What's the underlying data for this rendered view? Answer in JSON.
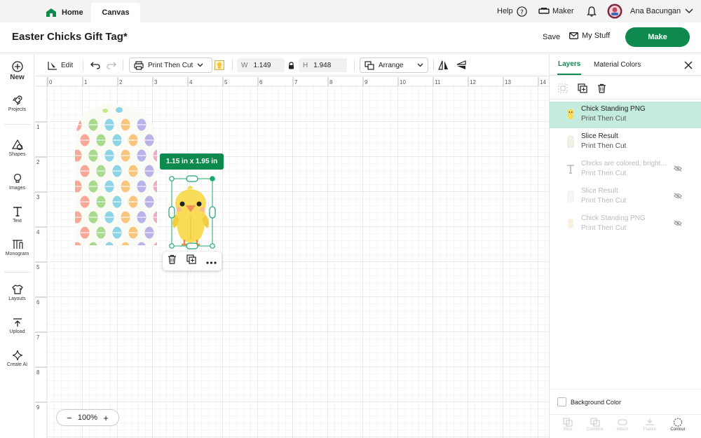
{
  "tabs": {
    "home": "Home",
    "canvas": "Canvas"
  },
  "top_right": {
    "help": "Help",
    "machine": "Maker",
    "user_name": "Ana Bacungan"
  },
  "project": {
    "title": "Easter Chicks Gift Tag*",
    "save": "Save",
    "my_stuff": "My Stuff",
    "make": "Make"
  },
  "left_nav": {
    "new": "New",
    "projects": "Projects",
    "shapes": "Shapes",
    "images": "Images",
    "text": "Text",
    "monogram": "Monogram",
    "layouts": "Layouts",
    "upload": "Upload",
    "create_ai": "Create AI"
  },
  "toolbar": {
    "edit": "Edit",
    "operation": "Print Then Cut",
    "w_label": "W",
    "w_value": "1.149",
    "h_label": "H",
    "h_value": "1.948",
    "arrange": "Arrange"
  },
  "ruler": {
    "horizontal": [
      "0",
      "1",
      "2",
      "3",
      "4",
      "5",
      "6",
      "7",
      "8",
      "9",
      "10",
      "11",
      "12",
      "13",
      "14"
    ],
    "vertical": [
      "1",
      "2",
      "3",
      "4",
      "5",
      "6",
      "7",
      "8",
      "9"
    ]
  },
  "canvas": {
    "size_badge": "1.15  in x 1.95  in",
    "zoom": "100%"
  },
  "panel": {
    "tab_layers": "Layers",
    "tab_material": "Material Colors",
    "layers": [
      {
        "name": "Chick Standing PNG",
        "sub": "Print Then Cut"
      },
      {
        "name": "Slice Result",
        "sub": "Print Then Cut"
      },
      {
        "name": "Chicks are colored, bright...",
        "sub": "Print Then Cut"
      },
      {
        "name": "Slice Result",
        "sub": "Print Then Cut"
      },
      {
        "name": "Chick Standing PNG",
        "sub": "Print Then Cut"
      }
    ],
    "background_color": "Background Color",
    "bottom_tools": {
      "slice": "Slice",
      "combine": "Combine",
      "attach": "Attach",
      "flatten": "Flatten",
      "contour": "Contour"
    }
  },
  "colors": {
    "brand": "#0e8a4e",
    "selected_layer": "#c4ecdc",
    "badge_text": "#ffffff"
  }
}
